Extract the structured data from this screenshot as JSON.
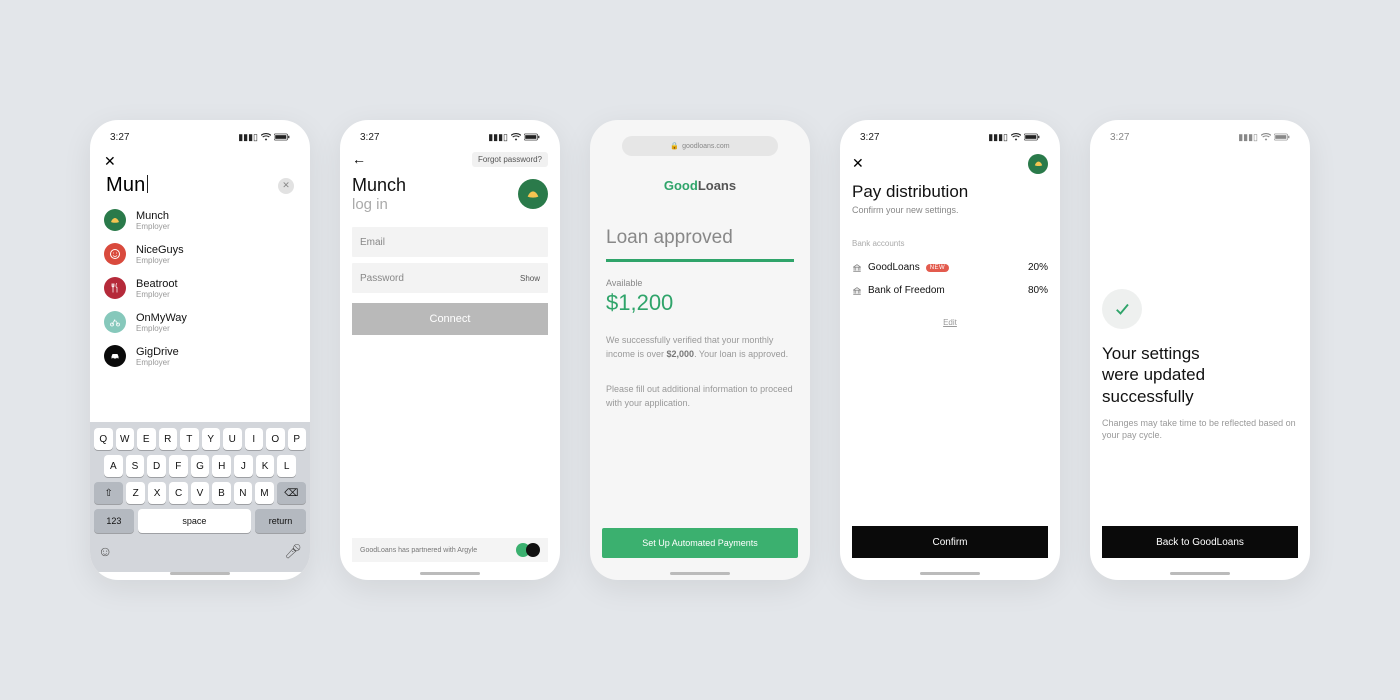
{
  "status": {
    "time": "3:27"
  },
  "screen1": {
    "search_value": "Mun",
    "employers": [
      {
        "name": "Munch",
        "sub": "Employer",
        "color": "#2a7a4a",
        "icon": "croissant"
      },
      {
        "name": "NiceGuys",
        "sub": "Employer",
        "color": "#d94a3d",
        "icon": "smile"
      },
      {
        "name": "Beatroot",
        "sub": "Employer",
        "color": "#b52a3a",
        "icon": "cutlery"
      },
      {
        "name": "OnMyWay",
        "sub": "Employer",
        "color": "#86c8bb",
        "icon": "bike"
      },
      {
        "name": "GigDrive",
        "sub": "Employer",
        "color": "#0a0a0a",
        "icon": "car"
      }
    ],
    "keyboard": {
      "row1": [
        "Q",
        "W",
        "E",
        "R",
        "T",
        "Y",
        "U",
        "I",
        "O",
        "P"
      ],
      "row2": [
        "A",
        "S",
        "D",
        "F",
        "G",
        "H",
        "J",
        "K",
        "L"
      ],
      "row3": [
        "Z",
        "X",
        "C",
        "V",
        "B",
        "N",
        "M"
      ],
      "num": "123",
      "space": "space",
      "ret": "return"
    }
  },
  "screen2": {
    "forgot": "Forgot password?",
    "title": "Munch",
    "subtitle": "log in",
    "email_placeholder": "Email",
    "password_placeholder": "Password",
    "show": "Show",
    "connect": "Connect",
    "partner_text": "GoodLoans has partnered with Argyle"
  },
  "screen3": {
    "url": "goodloans.com",
    "brand_good": "Good",
    "brand_loans": "Loans",
    "title": "Loan approved",
    "available_label": "Available",
    "available_amount": "$1,200",
    "verified_part1": "We successfully verified that your monthly income is over ",
    "verified_amount": "$2,000",
    "verified_part2": ". Your loan is approved.",
    "proceed_text": "Please fill out additional information to proceed with your application.",
    "setup_button": "Set Up Automated Payments"
  },
  "screen4": {
    "title": "Pay distribution",
    "subtitle": "Confirm your new settings.",
    "section": "Bank accounts",
    "accounts": [
      {
        "name": "GoodLoans",
        "pct": "20%",
        "is_new": true
      },
      {
        "name": "Bank of Freedom",
        "pct": "80%",
        "is_new": false
      }
    ],
    "new_label": "NEW",
    "edit": "Edit",
    "confirm": "Confirm"
  },
  "screen5": {
    "title_l1": "Your settings",
    "title_l2": "were updated",
    "title_l3": "successfully",
    "subtitle": "Changes may take time to be reflected based on your pay cycle.",
    "back": "Back to GoodLoans"
  }
}
